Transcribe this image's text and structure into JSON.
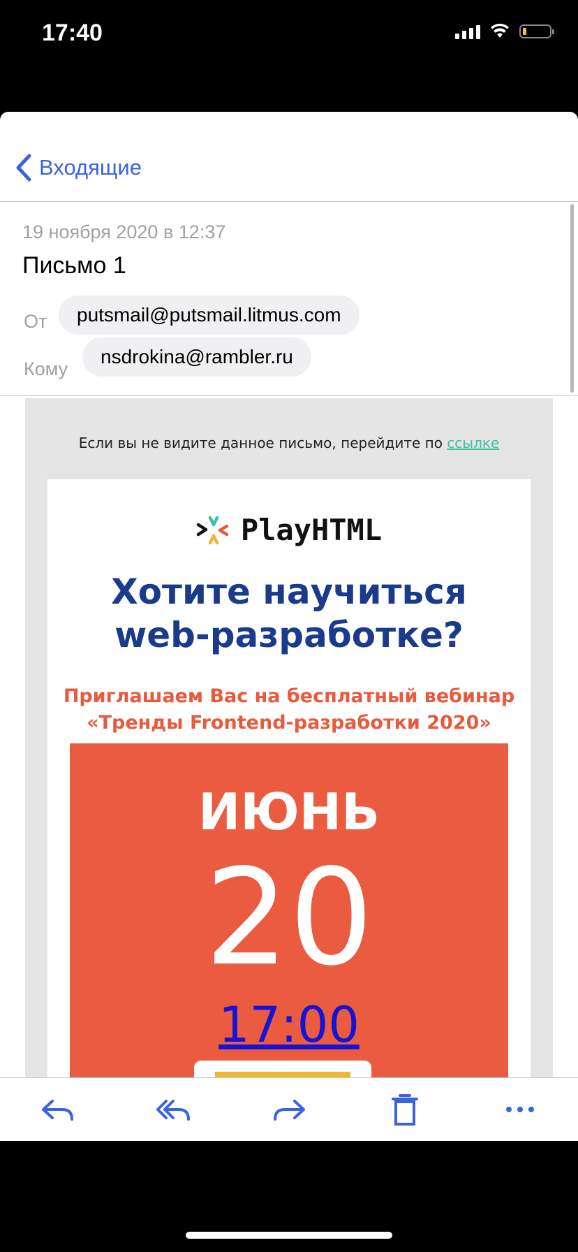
{
  "status": {
    "time": "17:40"
  },
  "nav": {
    "back_label": "Входящие"
  },
  "header": {
    "date": "19 ноября 2020 в 12:37",
    "subject": "Письмо 1",
    "from_label": "От",
    "from_value": "putsmail@putsmail.litmus.com",
    "to_label": "Кому",
    "to_value": "nsdrokina@rambler.ru"
  },
  "email": {
    "preheader_text": "Если вы не видите данное письмо, перейдите по ",
    "preheader_link": "ссылке",
    "logo_text": "PlayHTML",
    "headline_line1": "Хотите научиться",
    "headline_line2": "web-разработке?",
    "invite_line1": "Приглашаем Вас на бесплатный вебинар",
    "invite_line2": "«Тренды Frontend-разработки 2020»",
    "month": "ИЮНЬ",
    "day": "20",
    "time": "17:00"
  },
  "toolbar": {
    "icons": [
      "reply-icon",
      "reply-all-icon",
      "forward-icon",
      "trash-icon",
      "more-icon"
    ]
  },
  "colors": {
    "accent": "#3a63e0",
    "headline": "#1a3a8c",
    "invite": "#e85a3c",
    "date_block": "#eb5b40",
    "cta": "#f0b533",
    "link": "#3fc0a0"
  }
}
